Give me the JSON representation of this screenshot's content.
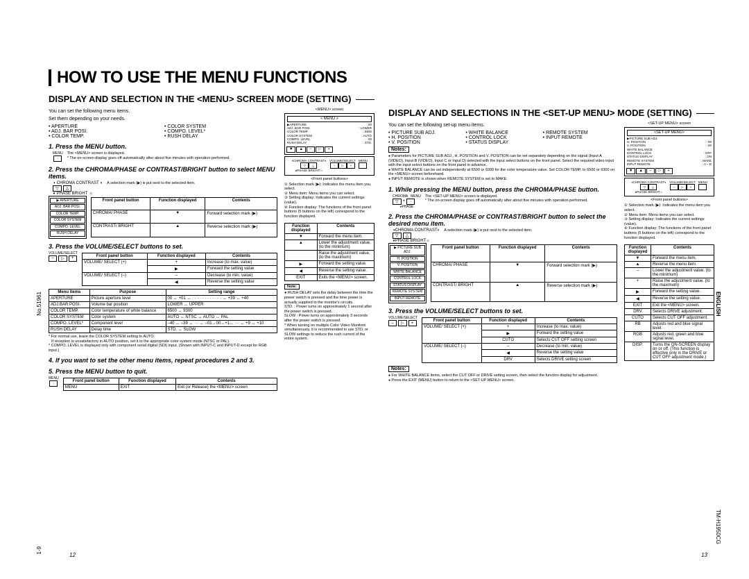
{
  "page_title": "HOW TO USE THE MENU FUNCTIONS",
  "side": {
    "no": "No.51961",
    "pn": "1-9",
    "model": "TM-H1950CG",
    "lang": "ENGLISH"
  },
  "pagenum": {
    "left": "12",
    "right": "13"
  },
  "left": {
    "heading": "DISPLAY AND SELECTION IN THE <MENU> SCREEN MODE (SETTING)",
    "intro1": "You can set the following menu items.",
    "intro2": "Set them depending on your needs.",
    "menu_items": [
      "APERTURE",
      "ADJ. BAR POSI.",
      "COLOR TEMP.",
      "COLOR SYSTEM",
      "COMPO. LEVEL*",
      "RUSH DELAY"
    ],
    "screen_caption": "<MENU> screen",
    "screen_rows": [
      [
        "APERTURE",
        ": 00"
      ],
      [
        "ADJ. BAR POSI.",
        ": LOWER"
      ],
      [
        "COLOR TEMP.",
        ": 6500"
      ],
      [
        "COLOR SYSTEM",
        ": AUTO"
      ],
      [
        "COMPO. LEVEL",
        ": 00"
      ],
      [
        "RUSH DELAY",
        ": STD."
      ]
    ],
    "front_caption": "<Front panel buttons>",
    "step1": "1. Press the MENU button.",
    "step1_body1": "The <MENU> screen is displayed.",
    "step1_body2": "* The on-screen display goes off automatically after about five minutes with operation performed.",
    "menu_btn": "MENU",
    "step2": "2. Press the CHROMA/PHASE or CONTRAST/BRIGHT button to select MENU items.",
    "step2_lead": "A selection mark (▶) is put next to the selected item.",
    "btn_labels1": "CHROMA  CONTRAST",
    "btn_labels2": "PHASE    BRIGHT",
    "tbl1_head": [
      "Front panel button",
      "Function displayed",
      "Contents"
    ],
    "tbl1_rows": [
      [
        "CHROMA/ PHASE",
        "▼",
        "Forward selection mark (▶)"
      ],
      [
        "CONTRAST/ BRIGHT",
        "▲",
        "Reverse selection mark (▶)"
      ]
    ],
    "mini_menu": [
      "APERTURE",
      "ADJ. BAR POSI.",
      "COLOR TEMP.",
      "COLOR SYSTEM",
      "COMPO. LEVEL",
      "RUSH DELAY"
    ],
    "step3": "3. Press the VOLUME/SELECT buttons to set.",
    "vol_label": "VOLUME/SELECT",
    "tbl2_head": [
      "Front panel button",
      "Function displayed",
      "Contents"
    ],
    "tbl2_rows": [
      [
        "VOLUME/ SELECT (+)",
        "+",
        "Increase (to max. value)"
      ],
      [
        "",
        "▶",
        "Forward the setting value"
      ],
      [
        "VOLUME/ SELECT (–)",
        "–",
        "Decrease (to min. value)"
      ],
      [
        "",
        "◀",
        "Reverse the setting value"
      ]
    ],
    "tbl3_head": [
      "Menu items",
      "Purpose",
      "Setting range"
    ],
    "tbl3_rows": [
      [
        "APERTURE",
        "Picture aperture level",
        "00 ↔ +01 ↔ · · · · · · · · · · · · ↔ +39 ↔ +40"
      ],
      [
        "ADJ.BAR POSI.",
        "Volume bar position",
        "LOWER ↔ UPPER"
      ],
      [
        "COLOR TEMP.",
        "Color temperature of white balance",
        "6500 ↔ 9300"
      ],
      [
        "COLOR SYSTEM",
        "Color system",
        "AUTO ↔ NTSC ↔ AUTO ↔ PAL"
      ],
      [
        "COMPO. LEVEL*",
        "Component level",
        "–40 ↔ –39 ↔ ··· ↔ –01↔00↔+1↔ ··· ↔ +9 ↔ +10"
      ],
      [
        "RUSH DELAY",
        "Delay time",
        "STD. ↔ SLOW"
      ]
    ],
    "foot1": "* For normal use, leave the COLOR SYSTEM setting to AUTO.",
    "foot2": "If reception is unsatisfactory in AUTO position, set it to the appropriate color system mode (NTSC or PAL).",
    "foot3": "* COMPO. LEVEL is displayed only with component serial digital (SDI) input. (Shown with INPUT-C and INPUT-D except for RGB input.)",
    "step4": "4. If you want to set the other menu items, repeat procedures 2 and 3.",
    "step5": "5. Press the MENU button to quit.",
    "tbl4_head": [
      "Front panel button",
      "Function displayed",
      "Contents"
    ],
    "tbl4_rows": [
      [
        "MENU",
        "EXIT",
        "Exit (or Release) the <MENU> screen"
      ]
    ],
    "aside_tbl_head": [
      "Function displayed",
      "Contents"
    ],
    "aside_tbl_rows": [
      [
        "▼",
        "Forward the menu item."
      ],
      [
        "▲",
        "Lower the adjustment value. (to the minimum)"
      ],
      [
        "",
        "Raise the adjustment value. (to the maximum)"
      ],
      [
        "▶",
        "Forward the setting value."
      ],
      [
        "◀",
        "Reverse the setting value."
      ],
      [
        "EXIT",
        "Exits the <MENU> screen."
      ]
    ],
    "note_label": "Note:",
    "note_lines": [
      "● RUSH DELAY sets the delay between the time the power switch is pressed and the time power is actually supplied to the monitor's circuits.",
      "STD. : Power turns on approximately 1 second after the power switch is pressed.",
      "SLOW : Power turns on approximately 3 seconds after the power switch is pressed.",
      "* When turning on multiple Color Video Monitors simultaneously, it is recommended to use STD. or SLOW settings to reduce the rush current of the entire system."
    ],
    "callouts": [
      "① Selection mark (▶): Indicates the menu item you select.",
      "② Menu item: Menu items you can select.",
      "③ Setting display: Indicates the current settings (value).",
      "④ Function display: The functions of the front panel buttons (5 buttons on the left) correspond to the function displayed."
    ]
  },
  "right": {
    "heading": "DISPLAY AND SELECTIONS IN THE <SET-UP MENU> MODE (SETTING)",
    "intro": "You can set the following set-up menu items.",
    "menu_items": [
      "PICTURE SUB ADJ.",
      "H. POSITION",
      "V. POSITION",
      "WHITE BALANCE",
      "CONTROL LOCK",
      "STATUS DISPLAY",
      "REMOTE SYSTEM",
      "INPUT REMOTE"
    ],
    "notes_label": "Notes:",
    "notes": [
      "Parameters for PICTURE SUB ADJ., H. POSITION and V. POSITION can be set separately depending on the signal (Input A (VIDEO), Input B (VIDEO), Input C or Input D) selected with the input select buttons on the front panel. Select the required video input with the input select buttons on the front panel in advance.",
      "WHITE BALANCE can be set independently at 6500 or 9300 for the color temperature value. Set COLOR TEMP. to 6500 or 9300 on the <MENU> screen beforehand.",
      "INPUT REMOTE is shown when REMOTE SYSTEM is set to MAKE."
    ],
    "screen_caption": "<SET-UP MENU> screen",
    "screen_rows": [
      [
        "PICTURE SUB ADJ.",
        ""
      ],
      [
        "H. POSITION",
        ": 00"
      ],
      [
        "V. POSITION",
        ": 00"
      ],
      [
        "WHITE BALANCE",
        ""
      ],
      [
        "CONTROL LOCK",
        ": OFF"
      ],
      [
        "STATUS DISPLAY",
        ": ON"
      ],
      [
        "REMOTE SYSTEM",
        ": MAKE"
      ],
      [
        "INPUT REMOTE",
        ": A – D"
      ]
    ],
    "front_caption": "<Front panel buttons>",
    "callouts": [
      "① Selection mark (▶): Indicates the menu item you select.",
      "② Menu item: Menu items you can select.",
      "③ Setting display: Indicates the current settings (value).",
      "④ Function display: The functions of the front panel buttons (5 buttons on the left) correspond to the function displayed."
    ],
    "step1": "1. While pressing the MENU button, press the CHROMA/PHASE button.",
    "step1_body1": "The <SET-UP MENU> screen is displayed.",
    "step1_body2": "* The on-screen display goes off automatically after about five minutes with operation performed.",
    "step2": "2. Press the CHROMA/PHASE or CONTRAST/BRIGHT button to select the desired menu item.",
    "step2_lead": "A selection mark (▶) is put next to the selected item.",
    "tbl1_head": [
      "Front panel button",
      "Function displayed",
      "Contents"
    ],
    "tbl1_rows": [
      [
        "CHROMA/ PHASE",
        "▼",
        "Forward selection mark (▶)"
      ],
      [
        "CONTRAST/ BRIGHT",
        "▲",
        "Reverse selection mark (▶)"
      ]
    ],
    "mini_menu": [
      "PICTURE SUB ADJ.",
      "H. POSITION",
      "V. POSITION",
      "WHITE BALANCE",
      "CONTROL LOCK",
      "STATUS DISPLAY",
      "REMOTE SYSTEM",
      "INPUT REMOTE"
    ],
    "step3": "3. Press the VOLUME/SELECT buttons to set.",
    "tbl2_head": [
      "Front panel button",
      "Function displayed",
      "Contents"
    ],
    "tbl2_rows": [
      [
        "VOLUME/ SELECT (+)",
        "+",
        "Increase (to max. value)"
      ],
      [
        "",
        "▶",
        "Forward the setting value"
      ],
      [
        "",
        "CUTO",
        "Selects CUT OFF setting screen"
      ],
      [
        "VOLUME/ SELECT (–)",
        "–",
        "Decrease (to min. value)"
      ],
      [
        "",
        "◀",
        "Reverse the setting value"
      ],
      [
        "",
        "DRV",
        "Selects DRIVE setting screen"
      ]
    ],
    "aside_tbl_head": [
      "Function displayed",
      "Contents"
    ],
    "aside_tbl_rows": [
      [
        "▼",
        "Forward the menu item."
      ],
      [
        "▲",
        "Reverse the menu item."
      ],
      [
        "–",
        "Lower the adjustment value. (to the minimum)"
      ],
      [
        "+",
        "Raise the adjustment value. (to the maximum)"
      ],
      [
        "▶",
        "Forward the setting value."
      ],
      [
        "◀",
        "Reverse the setting value."
      ],
      [
        "EXIT",
        "Exit the <MENU> screen."
      ],
      [
        "DRV",
        "Selects DRIVE adjustment."
      ],
      [
        "CUTO",
        "Selects CUT OFF adjustment."
      ],
      [
        "RB",
        "Adjusts red and blue signal level."
      ],
      [
        "RGB",
        "Adjusts red, green and blue signal level."
      ],
      [
        "DISP.",
        "Turns the ON-SCREEN display on or off. (This function is effective only in the DRIVE or CUT OFF adjustment mode.)"
      ]
    ],
    "notes2_label": "Notes:",
    "notes2": [
      "For WHITE BALANCE items, select the CUT OFF or DRIVE setting screen, then select the function display for adjustment.",
      "Press the EXIT (MENU) button to return to the <SET-UP MENU> screen."
    ]
  }
}
